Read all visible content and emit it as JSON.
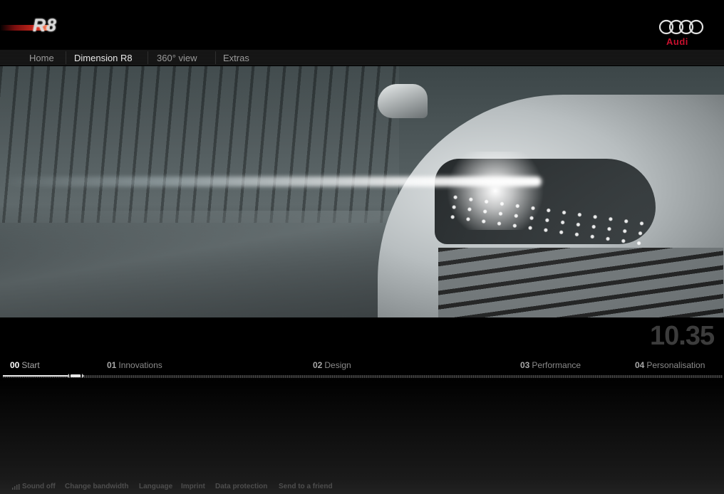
{
  "brand": {
    "model_logo": "R8",
    "maker_logo": "Audi"
  },
  "nav": {
    "items": [
      {
        "label": "Home"
      },
      {
        "label": "Dimension R8"
      },
      {
        "label": "360° view"
      },
      {
        "label": "Extras"
      }
    ],
    "active": "Dimension R8"
  },
  "player": {
    "timecode": "10.35",
    "chapters": [
      {
        "num": "00",
        "label": "Start"
      },
      {
        "num": "01",
        "label": "Innovations"
      },
      {
        "num": "02",
        "label": "Design"
      },
      {
        "num": "03",
        "label": "Performance"
      },
      {
        "num": "04",
        "label": "Personalisation"
      }
    ],
    "active_chapter": "00",
    "progress_fraction": 0.09
  },
  "footer": {
    "items": [
      {
        "label": "Sound off"
      },
      {
        "label": "Change bandwidth"
      },
      {
        "label": "Language"
      },
      {
        "label": "Imprint"
      },
      {
        "label": "Data protection"
      },
      {
        "label": "Send to a friend"
      }
    ]
  },
  "icons": {
    "sound": "sound-bars-icon",
    "playhead": "playhead-handle-icon",
    "audi_rings": "audi-rings-icon"
  },
  "colors": {
    "brand_red": "#c8102e",
    "background": "#000000",
    "active_text": "#e8e8e8",
    "inactive_text": "#9a9a9a"
  }
}
